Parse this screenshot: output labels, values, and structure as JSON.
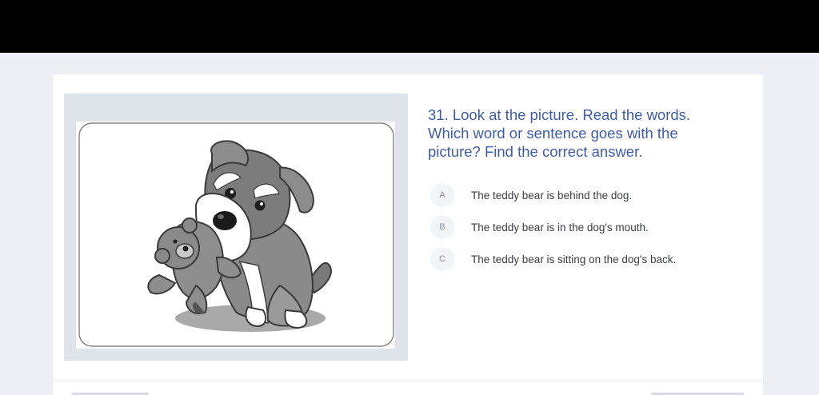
{
  "question": {
    "text": "31. Look at the picture. Read the words. Which word or sentence goes with the picture? Find the correct answer."
  },
  "options": [
    {
      "letter": "A",
      "text": "The teddy bear is behind the dog."
    },
    {
      "letter": "B",
      "text": "The teddy bear is in the dog's mouth."
    },
    {
      "letter": "C",
      "text": "The teddy bear is sitting on the dog's back."
    }
  ],
  "picture": {
    "subject": "dog-with-teddy-bear-illustration"
  },
  "colors": {
    "top_bar": "#000000",
    "page_background": "#edeff4",
    "card_background": "#ffffff",
    "image_panel": "#dfe3ea",
    "question_text": "#3e5bb0",
    "option_letter_bg": "#f2f4f8"
  }
}
